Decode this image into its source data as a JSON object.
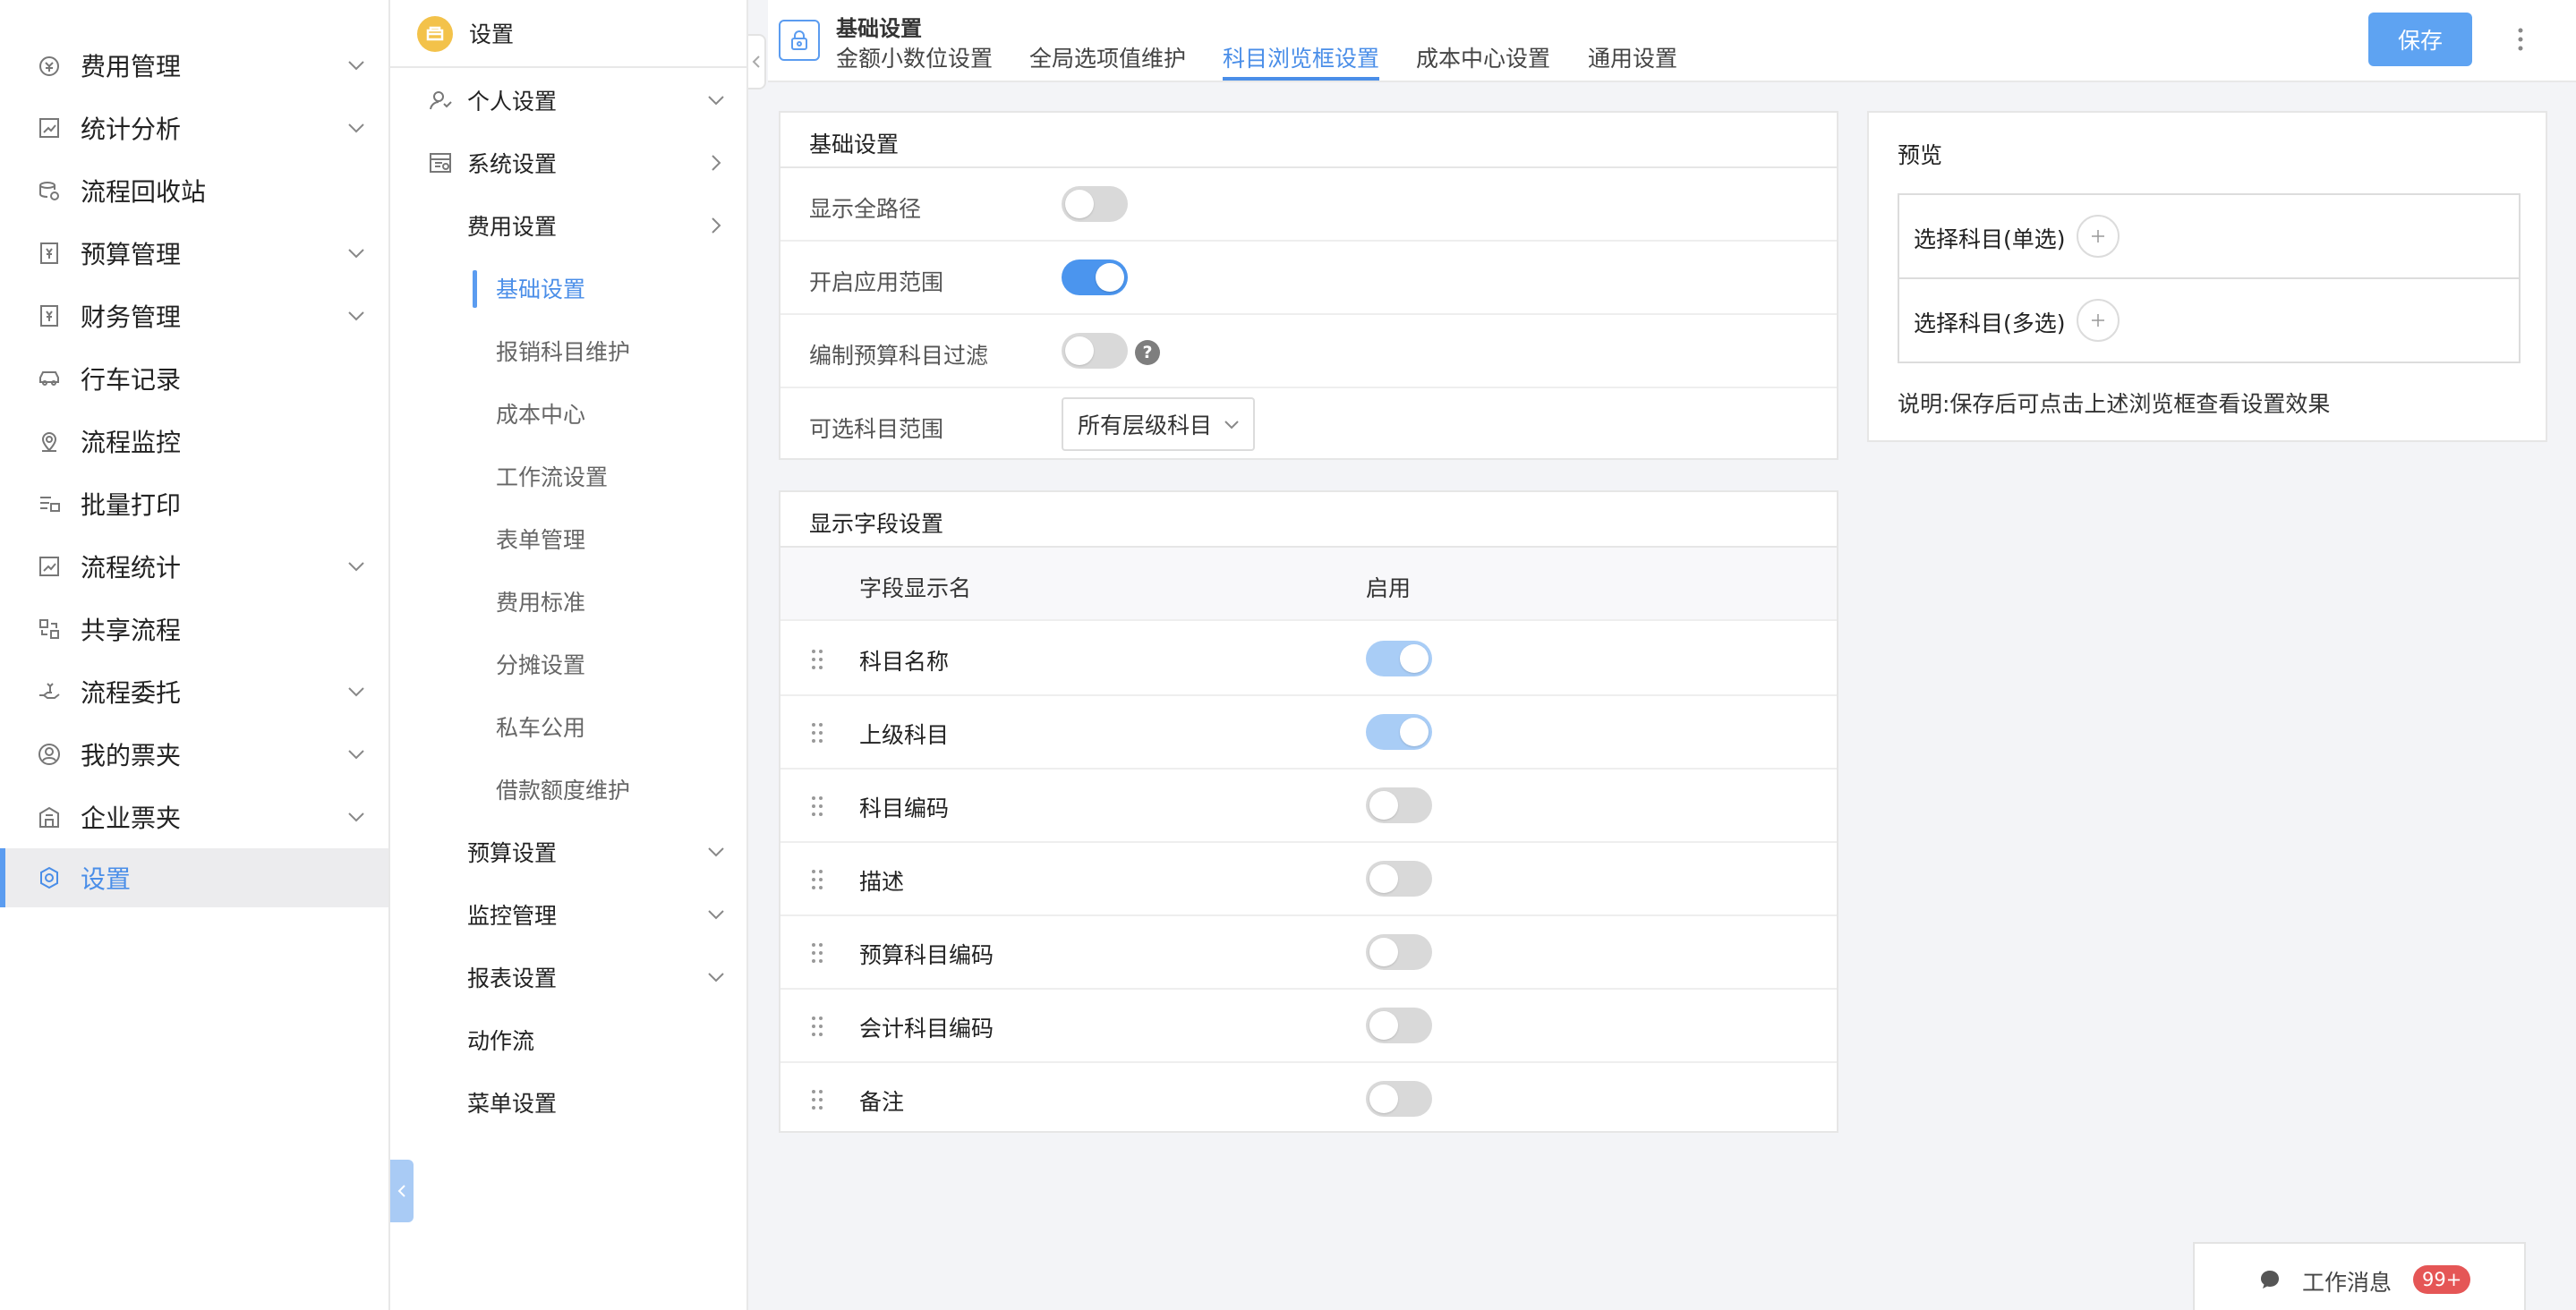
{
  "nav": {
    "items": [
      {
        "label": "费用管理",
        "icon": "expense-icon",
        "chevron": true
      },
      {
        "label": "统计分析",
        "icon": "chart-icon",
        "chevron": true
      },
      {
        "label": "流程回收站",
        "icon": "recycle-icon",
        "chevron": false
      },
      {
        "label": "预算管理",
        "icon": "budget-icon",
        "chevron": true
      },
      {
        "label": "财务管理",
        "icon": "finance-icon",
        "chevron": true
      },
      {
        "label": "行车记录",
        "icon": "car-icon",
        "chevron": false
      },
      {
        "label": "流程监控",
        "icon": "location-icon",
        "chevron": false
      },
      {
        "label": "批量打印",
        "icon": "print-icon",
        "chevron": false
      },
      {
        "label": "流程统计",
        "icon": "chart-icon",
        "chevron": true
      },
      {
        "label": "共享流程",
        "icon": "share-icon",
        "chevron": false
      },
      {
        "label": "流程委托",
        "icon": "hand-icon",
        "chevron": true
      },
      {
        "label": "我的票夹",
        "icon": "user-icon",
        "chevron": true
      },
      {
        "label": "企业票夹",
        "icon": "building-icon",
        "chevron": true
      },
      {
        "label": "设置",
        "icon": "gear-icon",
        "chevron": false,
        "active": true
      }
    ]
  },
  "submenu": {
    "title": "设置",
    "items": [
      {
        "label": "个人设置",
        "level": 1,
        "icon": "person-icon",
        "chevron": "down"
      },
      {
        "label": "系统设置",
        "level": 1,
        "icon": "window-icon",
        "chevron": "right"
      },
      {
        "label": "费用设置",
        "level": 2,
        "chevron": "right"
      },
      {
        "label": "基础设置",
        "level": 3,
        "active": true
      },
      {
        "label": "报销科目维护",
        "level": 3
      },
      {
        "label": "成本中心",
        "level": 3
      },
      {
        "label": "工作流设置",
        "level": 3
      },
      {
        "label": "表单管理",
        "level": 3
      },
      {
        "label": "费用标准",
        "level": 3
      },
      {
        "label": "分摊设置",
        "level": 3
      },
      {
        "label": "私车公用",
        "level": 3
      },
      {
        "label": "借款额度维护",
        "level": 3
      },
      {
        "label": "预算设置",
        "level": 2,
        "chevron": "down"
      },
      {
        "label": "监控管理",
        "level": 2,
        "chevron": "down"
      },
      {
        "label": "报表设置",
        "level": 2,
        "chevron": "down"
      },
      {
        "label": "动作流",
        "level": 2
      },
      {
        "label": "菜单设置",
        "level": 2
      }
    ]
  },
  "header": {
    "title": "基础设置",
    "tabs": [
      "金额小数位设置",
      "全局选项值维护",
      "科目浏览框设置",
      "成本中心设置",
      "通用设置"
    ],
    "active_tab": 2,
    "save_label": "保存"
  },
  "basic_settings": {
    "title": "基础设置",
    "rows": [
      {
        "label": "显示全路径",
        "toggle": "off"
      },
      {
        "label": "开启应用范围",
        "toggle": "on"
      },
      {
        "label": "编制预算科目过滤",
        "toggle": "off",
        "help": "?"
      },
      {
        "label": "可选科目范围",
        "select": "所有层级科目"
      }
    ]
  },
  "field_settings": {
    "title": "显示字段设置",
    "col_name": "字段显示名",
    "col_enabled": "启用",
    "rows": [
      {
        "name": "科目名称",
        "toggle": "disabled-on"
      },
      {
        "name": "上级科目",
        "toggle": "disabled-on"
      },
      {
        "name": "科目编码",
        "toggle": "off"
      },
      {
        "name": "描述",
        "toggle": "off"
      },
      {
        "name": "预算科目编码",
        "toggle": "off"
      },
      {
        "name": "会计科目编码",
        "toggle": "off"
      },
      {
        "name": "备注",
        "toggle": "off"
      }
    ]
  },
  "preview": {
    "title": "预览",
    "single_label": "选择科目(单选)",
    "multi_label": "选择科目(多选)",
    "note": "说明:保存后可点击上述浏览框查看设置效果"
  },
  "work_message": {
    "label": "工作消息",
    "count": "99+"
  },
  "colors": {
    "accent": "#4a8ee8",
    "button": "#5ea3f2",
    "badge": "#e55656",
    "logo": "#f3c24a"
  }
}
